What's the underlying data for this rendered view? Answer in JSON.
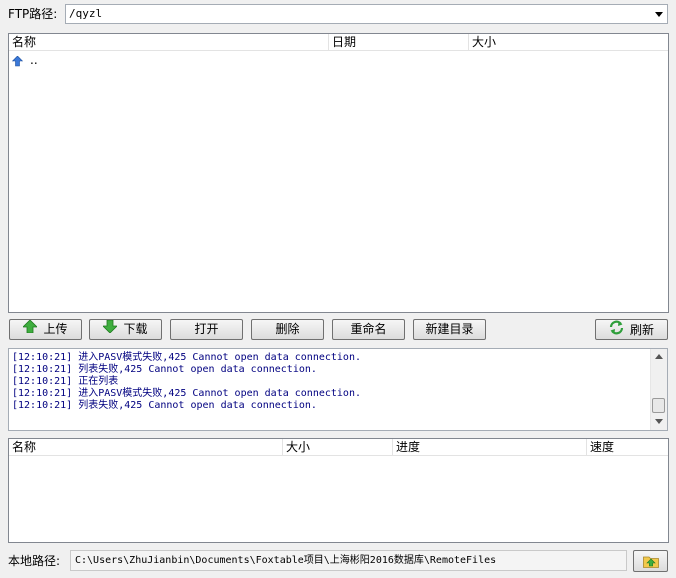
{
  "ftp": {
    "label": "FTP路径:",
    "path": "/qyzl"
  },
  "remote_list": {
    "columns": [
      "名称",
      "日期",
      "大小"
    ],
    "rows": [
      {
        "name": "..",
        "date": "",
        "size": ""
      }
    ]
  },
  "toolbar": {
    "upload": "上传",
    "download": "下载",
    "open": "打开",
    "delete": "删除",
    "rename": "重命名",
    "new_folder": "新建目录",
    "refresh": "刷新"
  },
  "log": [
    "[12:10:21] 进入PASV模式失败,425 Cannot open data connection.",
    "[12:10:21] 列表失败,425 Cannot open data connection.",
    "[12:10:21] 正在列表",
    "[12:10:21] 进入PASV模式失败,425 Cannot open data connection.",
    "[12:10:21] 列表失败,425 Cannot open data connection."
  ],
  "transfer_list": {
    "columns": [
      "名称",
      "大小",
      "进度",
      "速度"
    ]
  },
  "local": {
    "label": "本地路径:",
    "path": "C:\\Users\\ZhuJianbin\\Documents\\Foxtable项目\\上海彬阳2016数据库\\RemoteFiles"
  },
  "icons": {
    "up_folder": "up-arrow-icon",
    "upload": "green-up-arrow-icon",
    "download": "green-down-arrow-icon",
    "refresh": "green-refresh-icon",
    "local_browse": "folder-up-icon"
  }
}
